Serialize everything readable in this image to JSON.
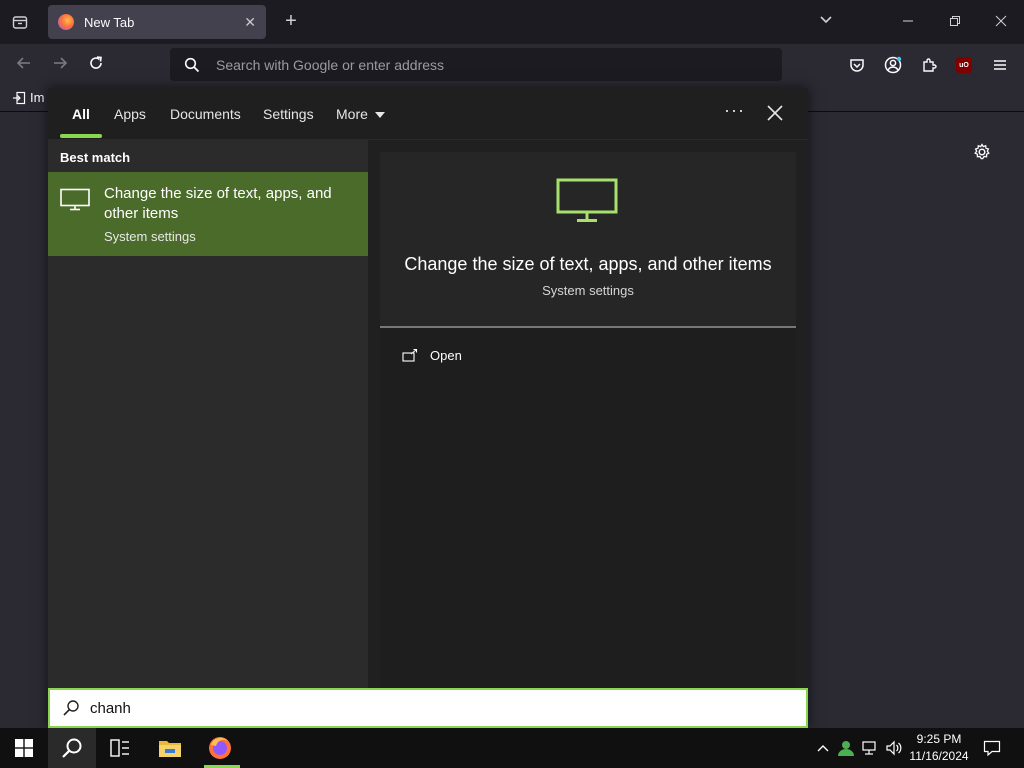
{
  "browser": {
    "tab_title": "New Tab",
    "tab_close": "✕",
    "new_tab": "+",
    "url_placeholder": "Search with Google or enter address",
    "bookmark_label": "Im"
  },
  "flyout": {
    "tabs": [
      "All",
      "Apps",
      "Documents",
      "Settings",
      "More"
    ],
    "dots": "···",
    "best_match_heading": "Best match",
    "result": {
      "title": "Change the size of text, apps, and other items",
      "subtitle": "System settings"
    },
    "preview": {
      "title": "Change the size of text, apps, and other items",
      "subtitle": "System settings",
      "open_label": "Open"
    },
    "search_value": "chanh",
    "accent": "#8bd650"
  },
  "taskbar": {
    "time": "9:25 PM",
    "date": "11/16/2024"
  }
}
